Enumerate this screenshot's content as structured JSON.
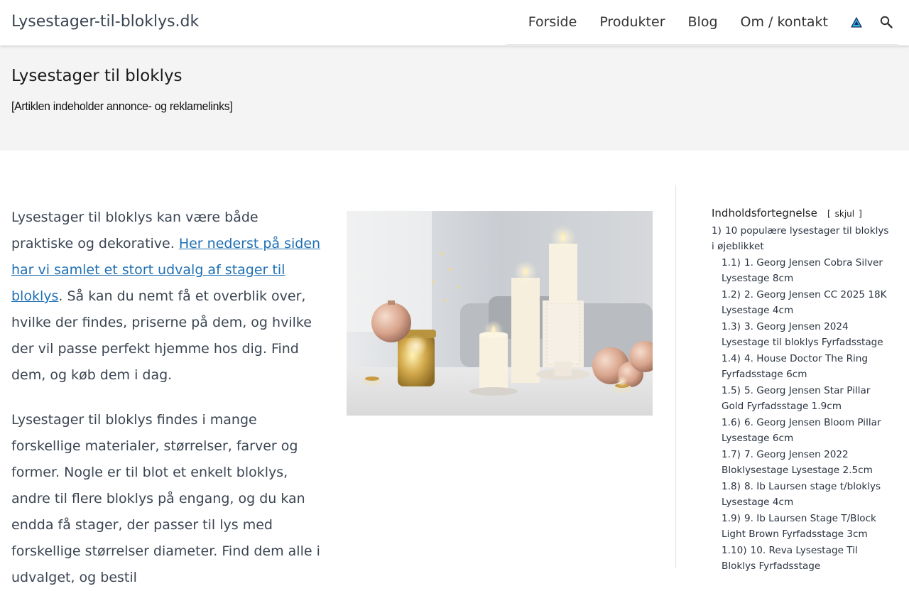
{
  "site": {
    "title": "Lysestager-til-bloklys.dk"
  },
  "nav": {
    "items": [
      "Forside",
      "Produkter",
      "Blog",
      "Om / kontakt"
    ],
    "icons": [
      "warning-triangle-icon",
      "search-icon"
    ]
  },
  "hero": {
    "title": "Lysestager til bloklys",
    "disclaimer": "[Artiklen indeholder annonce- og reklamelinks]"
  },
  "content": {
    "p1_before": "Lysestager til bloklys kan være både praktiske og dekorative. ",
    "p1_link": "Her nederst på siden har vi samlet et stort udvalg af stager til bloklys",
    "p1_after": ". Så kan du nemt få et overblik over, hvilke der findes, priserne på dem, og hvilke der vil passe perfekt hjemme hos dig. Find dem, og køb dem i dag.",
    "p2": "Lysestager til bloklys findes i mange forskellige materialer, størrelser, farver og former. Nogle er til blot et enkelt bloklys, andre til flere bloklys på engang, og du kan endda få stager, der passer til lys med forskellige størrelser diameter. Find dem alle i udvalget, og bestil"
  },
  "toc": {
    "title": "Indholdsfortegnelse",
    "toggle": "skjul",
    "toggle_open": "[",
    "toggle_close": "]",
    "items": [
      {
        "num": "1)",
        "label": "10 populære lysestager til bloklys i øjeblikket",
        "level": 1
      },
      {
        "num": "1.1)",
        "label": "1. Georg Jensen Cobra Silver Lysestage 8cm",
        "level": 2
      },
      {
        "num": "1.2)",
        "label": "2. Georg Jensen CC 2025 18K Lysestage 4cm",
        "level": 2
      },
      {
        "num": "1.3)",
        "label": "3. Georg Jensen 2024 Lysestage til bloklys Fyrfadsstage",
        "level": 2
      },
      {
        "num": "1.4)",
        "label": "4. House Doctor The Ring Fyrfadsstage 6cm",
        "level": 2
      },
      {
        "num": "1.5)",
        "label": "5. Georg Jensen Star Pillar Gold Fyrfadsstage 1.9cm",
        "level": 2
      },
      {
        "num": "1.6)",
        "label": "6. Georg Jensen Bloom Pillar Lysestage 6cm",
        "level": 2
      },
      {
        "num": "1.7)",
        "label": "7. Georg Jensen 2022 Bloklysestage Lysestage 2.5cm",
        "level": 2
      },
      {
        "num": "1.8)",
        "label": "8. Ib Laursen stage t/bloklys Lysestage 4cm",
        "level": 2
      },
      {
        "num": "1.9)",
        "label": "9. Ib Laursen Stage T/Block Light Brown Fyrfadsstage 3cm",
        "level": 2
      },
      {
        "num": "1.10)",
        "label": "10. Reva Lysestage Til Bloklys Fyrfadsstage",
        "level": 2
      }
    ]
  },
  "colors": {
    "link": "#1f6fb3",
    "hero_bg": "#f4f4f4",
    "text": "#3b4552"
  }
}
